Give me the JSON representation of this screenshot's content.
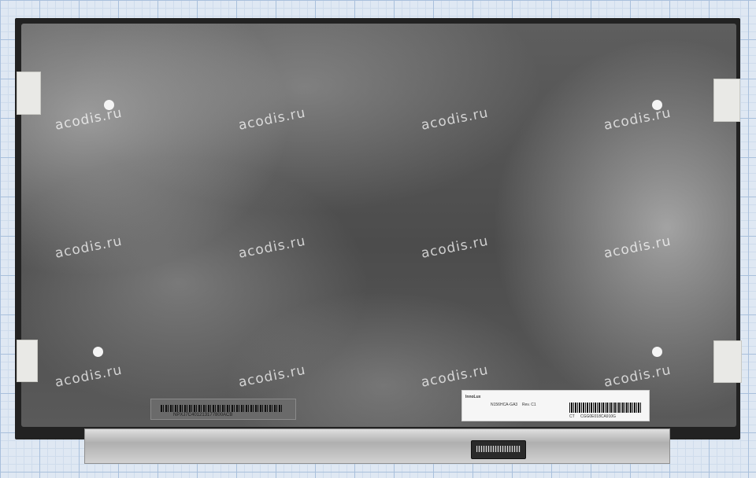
{
  "watermark": {
    "text": "acodis.ru",
    "count": 12
  },
  "panel": {
    "manufacturer": "InnoLux",
    "model": "N156HCA-GA3",
    "revision": "Rev. C1",
    "serial_barcode_text": "CGG0E018CA910G",
    "serial_prefix": "CT",
    "left_barcode_text": "NPXJ7C401213177800ACB"
  },
  "colors": {
    "panel_frame": "#222222",
    "screen": "#555555",
    "grid_paper": "#dfe8f3"
  }
}
